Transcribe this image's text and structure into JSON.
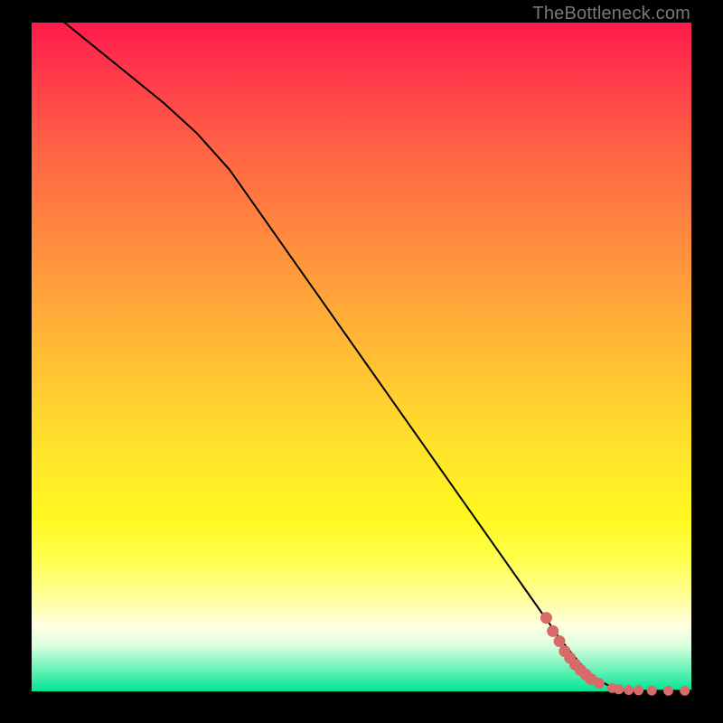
{
  "watermark": "TheBottleneck.com",
  "colors": {
    "marker_fill": "#d86a6a",
    "marker_stroke": "#d86a6a",
    "line": "#000000"
  },
  "chart_data": {
    "type": "line",
    "title": "",
    "xlabel": "",
    "ylabel": "",
    "xlim": [
      0,
      100
    ],
    "ylim": [
      0,
      100
    ],
    "series": [
      {
        "name": "curve",
        "x": [
          5,
          10,
          15,
          20,
          25,
          30,
          35,
          40,
          45,
          50,
          55,
          60,
          65,
          70,
          75,
          80,
          82,
          84,
          86,
          88,
          90,
          92,
          94,
          96,
          98,
          100
        ],
        "y": [
          100,
          96,
          92,
          88,
          83.5,
          78,
          71,
          64,
          57,
          50,
          43,
          36,
          29,
          22,
          15,
          8,
          5.5,
          3.2,
          1.6,
          0.6,
          0.2,
          0.1,
          0.1,
          0.1,
          0.1,
          0.1
        ]
      }
    ],
    "scatter": {
      "name": "points",
      "x": [
        78,
        79,
        80,
        80.8,
        81.6,
        82.4,
        83.2,
        84,
        84.8,
        86,
        88,
        89,
        90.5,
        92,
        94,
        96.5,
        99
      ],
      "y": [
        11,
        9,
        7.5,
        6,
        5,
        4,
        3.2,
        2.5,
        1.8,
        1.2,
        0.5,
        0.3,
        0.2,
        0.15,
        0.12,
        0.1,
        0.1
      ],
      "r": [
        6,
        6,
        6,
        6,
        6,
        6,
        6,
        6,
        6,
        5.5,
        5,
        5,
        5,
        5,
        5,
        5,
        5
      ]
    }
  }
}
